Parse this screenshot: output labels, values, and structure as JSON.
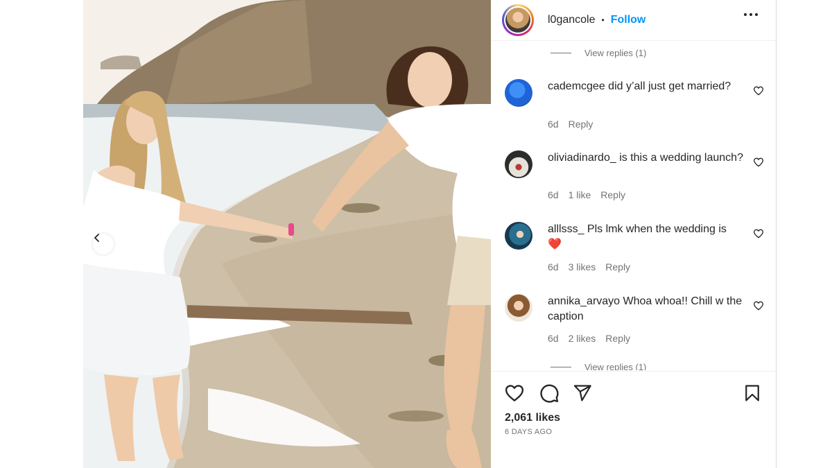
{
  "post": {
    "username": "l0gancole",
    "separator": "•",
    "follow_label": "Follow",
    "likes": "2,061 likes",
    "date": "6 DAYS AGO"
  },
  "icons": {
    "more": "more-options-icon",
    "like": "heart-icon",
    "comment": "comment-icon",
    "share": "share-icon",
    "save": "bookmark-icon",
    "carousel_prev": "chevron-left-icon"
  },
  "colors": {
    "follow_blue": "#0095f6",
    "muted_text": "#737373",
    "border": "#dbdbdb"
  },
  "comments": {
    "view_replies_top": "View replies (1)",
    "view_replies_bottom": "View replies (1)",
    "items": [
      {
        "username": "cademcgee",
        "text": "did y’all just get married?",
        "time": "6d",
        "likes": "",
        "reply_label": "Reply"
      },
      {
        "username": "oliviadinardo_",
        "text": "is this a wedding launch?",
        "time": "6d",
        "likes": "1 like",
        "reply_label": "Reply"
      },
      {
        "username": "alllsss_",
        "text": "Pls lmk when the wedding is",
        "emoji": "❤️",
        "time": "6d",
        "likes": "3 likes",
        "reply_label": "Reply"
      },
      {
        "username": "annika_arvayo",
        "text": "Whoa whoa!! Chill w the caption",
        "time": "6d",
        "likes": "2 likes",
        "reply_label": "Reply"
      }
    ]
  }
}
